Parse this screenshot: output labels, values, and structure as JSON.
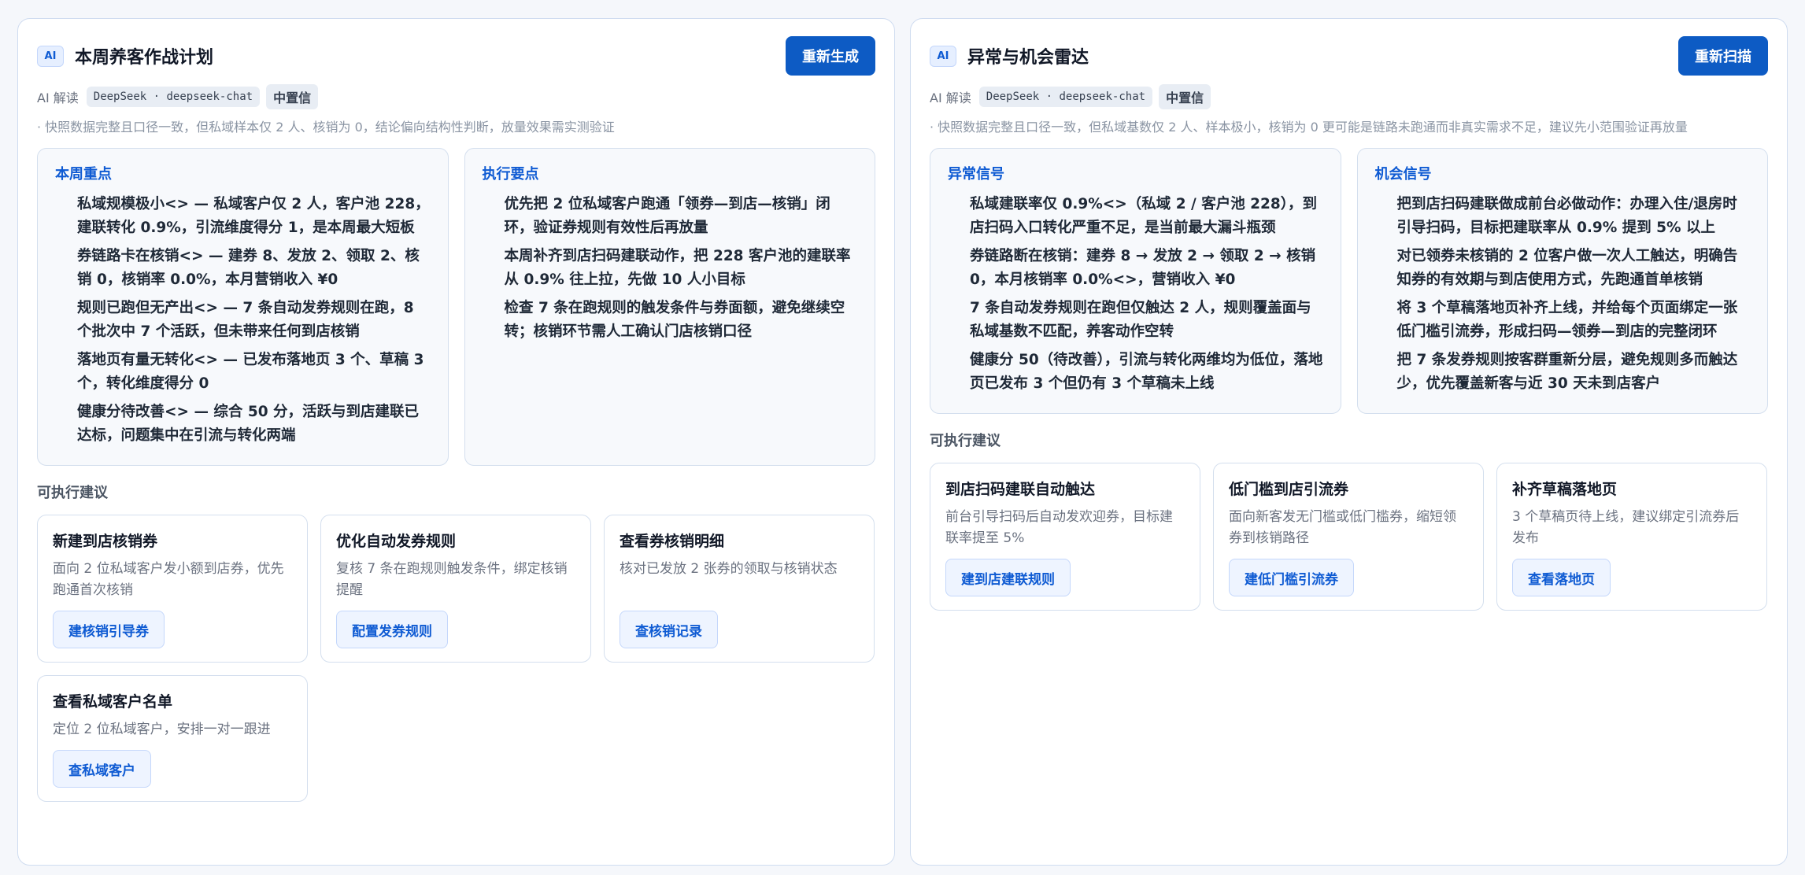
{
  "left": {
    "badge": "AI",
    "title": "本周养客作战计划",
    "regen_label": "重新生成",
    "meta_label": "AI 解读",
    "model": "DeepSeek · deepseek-chat",
    "confidence": "中置信",
    "caveat": "· 快照数据完整且口径一致，但私域样本仅 2 人、核销为 0，结论偏向结构性判断，放量效果需实测验证",
    "focus_title": "本周重点",
    "focus": [
      "私域规模极小<> — 私域客户仅 2 人，客户池 228，建联转化 0.9%，引流维度得分 1，是本周最大短板",
      "券链路卡在核销<> — 建券 8、发放 2、领取 2、核销 0，核销率 0.0%，本月营销收入 ¥0",
      "规则已跑但无产出<> — 7 条自动发券规则在跑，8 个批次中 7 个活跃，但未带来任何到店核销",
      "落地页有量无转化<> — 已发布落地页 3 个、草稿 3 个，转化维度得分 0",
      "健康分待改善<> — 综合 50 分，活跃与到店建联已达标，问题集中在引流与转化两端"
    ],
    "exec_title": "执行要点",
    "exec": [
      "优先把 2 位私域客户跑通「领券—到店—核销」闭环，验证券规则有效性后再放量",
      "本周补齐到店扫码建联动作，把 228 客户池的建联率从 0.9% 往上拉，先做 10 人小目标",
      "检查 7 条在跑规则的触发条件与券面额，避免继续空转；核销环节需人工确认门店核销口径"
    ],
    "actions_title": "可执行建议",
    "actions": [
      {
        "title": "新建到店核销券",
        "desc": "面向 2 位私域客户发小额到店券，优先跑通首次核销",
        "button": "建核销引导券"
      },
      {
        "title": "优化自动发券规则",
        "desc": "复核 7 条在跑规则触发条件，绑定核销提醒",
        "button": "配置发券规则"
      },
      {
        "title": "查看券核销明细",
        "desc": "核对已发放 2 张券的领取与核销状态",
        "button": "查核销记录"
      },
      {
        "title": "查看私域客户名单",
        "desc": "定位 2 位私域客户，安排一对一跟进",
        "button": "查私域客户"
      }
    ]
  },
  "right": {
    "badge": "AI",
    "title": "异常与机会雷达",
    "regen_label": "重新扫描",
    "meta_label": "AI 解读",
    "model": "DeepSeek · deepseek-chat",
    "confidence": "中置信",
    "caveat": "· 快照数据完整且口径一致，但私域基数仅 2 人、样本极小，核销为 0 更可能是链路未跑通而非真实需求不足，建议先小范围验证再放量",
    "anomaly_title": "异常信号",
    "anomaly": [
      "私域建联率仅 0.9%<>（私域 2 / 客户池 228），到店扫码入口转化严重不足，是当前最大漏斗瓶颈",
      "券链路断在核销：建券 8 → 发放 2 → 领取 2 → 核销 0，本月核销率 0.0%<>，营销收入 ¥0",
      "7 条自动发券规则在跑但仅触达 2 人，规则覆盖面与私域基数不匹配，养客动作空转",
      "健康分 50（待改善），引流与转化两维均为低位，落地页已发布 3 个但仍有 3 个草稿未上线"
    ],
    "opp_title": "机会信号",
    "opp": [
      "把到店扫码建联做成前台必做动作：办理入住/退房时引导扫码，目标把建联率从 0.9% 提到 5% 以上",
      "对已领券未核销的 2 位客户做一次人工触达，明确告知券的有效期与到店使用方式，先跑通首单核销",
      "将 3 个草稿落地页补齐上线，并给每个页面绑定一张低门槛引流券，形成扫码—领券—到店的完整闭环",
      "把 7 条发券规则按客群重新分层，避免规则多而触达少，优先覆盖新客与近 30 天未到店客户"
    ],
    "actions_title": "可执行建议",
    "actions": [
      {
        "title": "到店扫码建联自动触达",
        "desc": "前台引导扫码后自动发欢迎券，目标建联率提至 5%",
        "button": "建到店建联规则"
      },
      {
        "title": "低门槛到店引流券",
        "desc": "面向新客发无门槛或低门槛券，缩短领券到核销路径",
        "button": "建低门槛引流券"
      },
      {
        "title": "补齐草稿落地页",
        "desc": "3 个草稿页待上线，建议绑定引流券后发布",
        "button": "查看落地页"
      }
    ]
  }
}
